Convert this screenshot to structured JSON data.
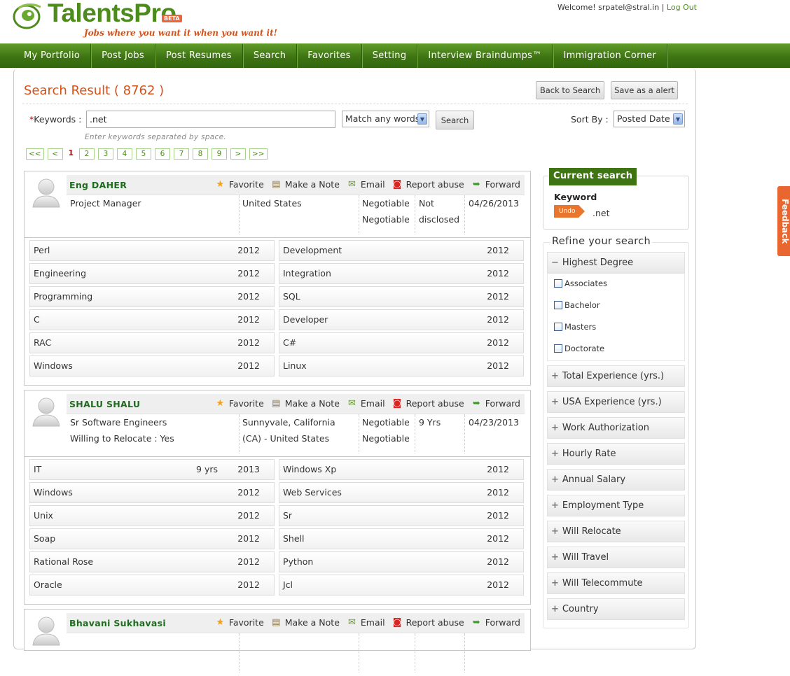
{
  "brand": {
    "name": "TalentsPro",
    "badge": "BETA",
    "tagline": "Jobs where you want it when you want it!"
  },
  "user": {
    "welcome": "Welcome! srpatel@stral.in",
    "separator": "|",
    "logout": "Log Out"
  },
  "nav": [
    "My Portfolio",
    "Post Jobs",
    "Post Resumes",
    "Search",
    "Favorites",
    "Setting",
    "Interview Braindumps™",
    "Immigration Corner"
  ],
  "page": {
    "title": "Search Result ( 8762 )",
    "back_button": "Back to Search",
    "alert_button": "Save as a alert"
  },
  "search": {
    "required_mark": "*",
    "keywords_label": "Keywords :",
    "keywords_value": ".net",
    "match_mode": "Match any words",
    "search_button": "Search",
    "hint": "Enter keywords separated by space.",
    "sort_label": "Sort By :",
    "sort_value": "Posted Date"
  },
  "pagination": [
    "<<",
    "<",
    "1",
    "2",
    "3",
    "4",
    "5",
    "6",
    "7",
    "8",
    "9",
    ">",
    ">>"
  ],
  "pagination_current": "1",
  "actions": {
    "favorite": "Favorite",
    "note": "Make a Note",
    "email": "Email",
    "report": "Report abuse",
    "forward": "Forward"
  },
  "results": [
    {
      "name": "Eng DAHER",
      "title": "Project Manager",
      "relocate": "",
      "location": "United States",
      "location2": "",
      "rate1": "Negotiable",
      "rate2": "Negotiable",
      "experience": "Not",
      "experience2": "disclosed",
      "date": "04/26/2013",
      "skills": [
        {
          "name": "Perl",
          "yrs": "",
          "year": "2012"
        },
        {
          "name": "Development",
          "yrs": "",
          "year": "2012"
        },
        {
          "name": "Engineering",
          "yrs": "",
          "year": "2012"
        },
        {
          "name": "Integration",
          "yrs": "",
          "year": "2012"
        },
        {
          "name": "Programming",
          "yrs": "",
          "year": "2012"
        },
        {
          "name": "SQL",
          "yrs": "",
          "year": "2012"
        },
        {
          "name": "C",
          "yrs": "",
          "year": "2012"
        },
        {
          "name": "Developer",
          "yrs": "",
          "year": "2012"
        },
        {
          "name": "RAC",
          "yrs": "",
          "year": "2012"
        },
        {
          "name": "C#",
          "yrs": "",
          "year": "2012"
        },
        {
          "name": "Windows",
          "yrs": "",
          "year": "2012"
        },
        {
          "name": "Linux",
          "yrs": "",
          "year": "2012"
        }
      ]
    },
    {
      "name": "SHALU SHALU",
      "title": "Sr Software Engineers",
      "relocate": "Willing to Relocate : Yes",
      "location": "Sunnyvale, California",
      "location2": "(CA) - United States",
      "rate1": "Negotiable",
      "rate2": "Negotiable",
      "experience": "9 Yrs",
      "experience2": "",
      "date": "04/23/2013",
      "skills": [
        {
          "name": "IT",
          "yrs": "9 yrs",
          "year": "2013"
        },
        {
          "name": "Windows Xp",
          "yrs": "",
          "year": "2012"
        },
        {
          "name": "Windows",
          "yrs": "",
          "year": "2012"
        },
        {
          "name": "Web Services",
          "yrs": "",
          "year": "2012"
        },
        {
          "name": "Unix",
          "yrs": "",
          "year": "2012"
        },
        {
          "name": "Sr",
          "yrs": "",
          "year": "2012"
        },
        {
          "name": "Soap",
          "yrs": "",
          "year": "2012"
        },
        {
          "name": "Shell",
          "yrs": "",
          "year": "2012"
        },
        {
          "name": "Rational Rose",
          "yrs": "",
          "year": "2012"
        },
        {
          "name": "Python",
          "yrs": "",
          "year": "2012"
        },
        {
          "name": "Oracle",
          "yrs": "",
          "year": "2012"
        },
        {
          "name": "Jcl",
          "yrs": "",
          "year": "2012"
        }
      ]
    },
    {
      "name": "Bhavani Sukhavasi"
    }
  ],
  "sidebar": {
    "current_title": "Current search",
    "keyword_label": "Keyword",
    "undo": "Undo",
    "keyword_value": ".net",
    "refine_title": "Refine your search",
    "degree_title": "Highest Degree",
    "degree_symbol": "−",
    "degrees": [
      "Associates",
      "Bachelor",
      "Masters",
      "Doctorate"
    ],
    "filter_symbol": "+",
    "filters": [
      "Total Experience (yrs.)",
      "USA Experience (yrs.)",
      "Work Authorization",
      "Hourly Rate",
      "Annual Salary",
      "Employment Type",
      "Will Relocate",
      "Will Travel",
      "Will Telecommute",
      "Country"
    ]
  },
  "feedback": "Feedback",
  "colors": {
    "brand_green": "#4d8c1c",
    "nav_green": "#3e7412",
    "accent_orange": "#d2521a",
    "name_green": "#1f6b1f"
  }
}
